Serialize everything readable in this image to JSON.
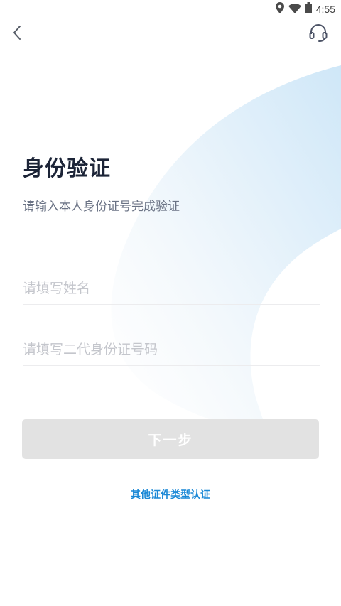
{
  "status_bar": {
    "time": "4:55",
    "icons": [
      "location-icon",
      "wifi-icon",
      "battery-icon"
    ]
  },
  "nav": {
    "back_icon": "chevron-left-icon",
    "support_icon": "headset-icon"
  },
  "page": {
    "title": "身份验证",
    "subtitle": "请输入本人身份证号完成验证"
  },
  "form": {
    "name_placeholder": "请填写姓名",
    "id_placeholder": "请填写二代身份证号码",
    "name_value": "",
    "id_value": ""
  },
  "actions": {
    "next_label": "下一步",
    "other_link": "其他证件类型认证"
  },
  "colors": {
    "title": "#1c2437",
    "subtitle": "#6b7385",
    "placeholder": "#c4c6cc",
    "button_disabled_bg": "#e2e2e2",
    "link": "#1a88d6",
    "decor_blue": "#dcedf9"
  }
}
